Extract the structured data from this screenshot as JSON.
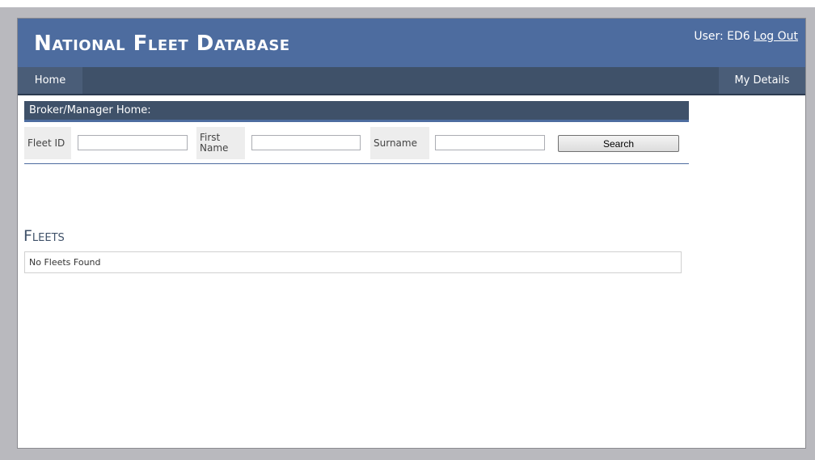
{
  "header": {
    "site_title": "National Fleet Database",
    "user_label": "User: ED6",
    "logout_label": "Log Out"
  },
  "nav": {
    "home_label": "Home",
    "my_details_label": "My Details"
  },
  "search": {
    "section_title": "Broker/Manager Home:",
    "fleet_id_label": "Fleet ID",
    "fleet_id_value": "",
    "first_name_label": "First Name",
    "first_name_value": "",
    "surname_label": "Surname",
    "surname_value": "",
    "search_button_label": "Search"
  },
  "fleets": {
    "heading": "Fleets",
    "empty_message": "No Fleets Found"
  },
  "colors": {
    "header_bg": "#4d6c9f",
    "nav_bg": "#3f5169",
    "page_bg": "#b9b9be"
  }
}
